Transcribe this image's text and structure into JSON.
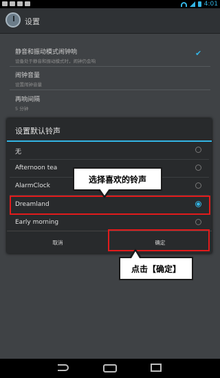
{
  "status_bar": {
    "time": "4:01"
  },
  "header": {
    "title": "设置"
  },
  "settings": [
    {
      "title": "静音和振动模式闹钟响",
      "subtitle": "设备处于静音和振动模式时，闹钟仍会响"
    },
    {
      "title": "闹钟音量",
      "subtitle": "设置闹钟音量"
    },
    {
      "title": "再响间隔",
      "subtitle": "5 分钟"
    }
  ],
  "dialog": {
    "title": "设置默认铃声",
    "options": [
      {
        "label": "无",
        "selected": false
      },
      {
        "label": "Afternoon tea",
        "selected": false
      },
      {
        "label": "AlarmClock",
        "selected": false
      },
      {
        "label": "Dreamland",
        "selected": true
      },
      {
        "label": "Early morning",
        "selected": false
      }
    ],
    "cancel_label": "取消",
    "ok_label": "确定"
  },
  "callouts": {
    "choose_ringtone": "选择喜欢的铃声",
    "click_ok": "点击【确定】"
  },
  "colors": {
    "accent": "#33b5e5",
    "highlight": "#e21b1b"
  }
}
